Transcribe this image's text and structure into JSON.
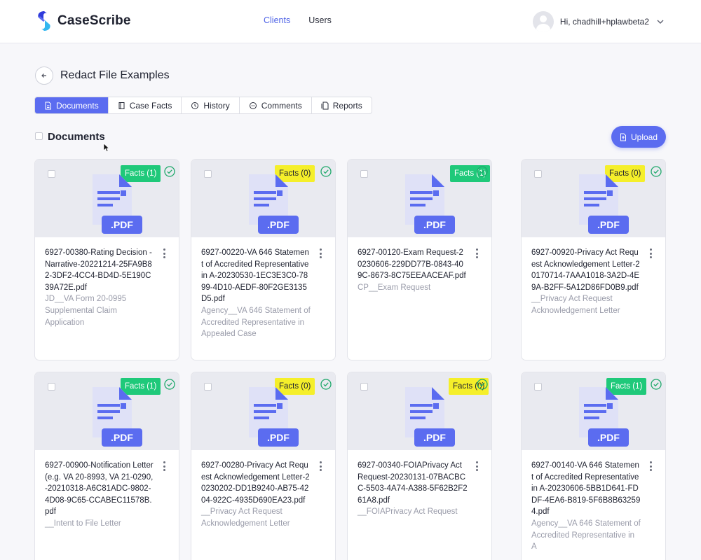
{
  "app": {
    "name": "CaseScribe"
  },
  "nav": {
    "clients": "Clients",
    "users": "Users"
  },
  "user": {
    "greeting": "Hi, chadhill+hplawbeta2"
  },
  "page": {
    "title": "Redact File Examples"
  },
  "tabs": [
    {
      "label": "Documents",
      "icon": "document-icon",
      "active": true
    },
    {
      "label": "Case Facts",
      "icon": "book-icon",
      "active": false
    },
    {
      "label": "History",
      "icon": "history-icon",
      "active": false
    },
    {
      "label": "Comments",
      "icon": "comments-icon",
      "active": false
    },
    {
      "label": "Reports",
      "icon": "reports-icon",
      "active": false
    }
  ],
  "section": {
    "title": "Documents",
    "upload_label": "Upload"
  },
  "colors": {
    "accent": "#5b6cf0",
    "facts_green": "#1fc97a",
    "facts_yellow": "#f5ef2a",
    "check_green": "#1ea86a"
  },
  "documents": [
    {
      "facts": "Facts (1)",
      "facts_color": "green",
      "name": "6927-00380-Rating Decision - Narrative-20221214-25FA9B82-3DF2-4CC4-BD4D-5E190C39A72E.pdf",
      "desc": "JD__VA Form 20-0995 Supplemental Claim Application"
    },
    {
      "facts": "Facts (0)",
      "facts_color": "yellow",
      "name": "6927-00220-VA 646 Statement of Accredited Representative in A-20230530-1EC3E3C0-7899-4D10-AEDF-80F2GE3135D5.pdf",
      "desc": "Agency__VA 646 Statement of Accredited Representative in Appealed Case"
    },
    {
      "facts": "Facts (1)",
      "facts_color": "green",
      "name": "6927-00120-Exam Request-20230606-229DD77B-0843-409C-8673-8C75EEAACEAF.pdf",
      "desc": "CP__Exam Request"
    },
    {
      "facts": "Facts (0)",
      "facts_color": "yellow",
      "name": "6927-00920-Privacy Act Request Acknowledgement Letter-20170714-7AAA1018-3A2D-4E9A-B2FF-5A12D86FD0B9.pdf",
      "desc": "__Privacy Act Request Acknowledgement Letter"
    },
    {
      "facts": "Facts (1)",
      "facts_color": "green",
      "name": "6927-00900-Notification Letter (e.g. VA 20-8993, VA 21-0290, -20210318-A6C81ADC-9802-4D08-9C65-CCABEC11578B.pdf",
      "desc": "__Intent to File Letter"
    },
    {
      "facts": "Facts (0)",
      "facts_color": "yellow",
      "name": "6927-00280-Privacy Act Request Acknowledgement Letter-20230202-DD1B9240-AB75-4204-922C-4935D690EA23.pdf",
      "desc": "__Privacy Act Request Acknowledgement Letter"
    },
    {
      "facts": "Facts (0)",
      "facts_color": "yellow",
      "name": "6927-00340-FOIAPrivacy Act Request-20230131-07BACBCC-5503-4A74-A388-5F62B2F261A8.pdf",
      "desc": "__FOIAPrivacy Act Request"
    },
    {
      "facts": "Facts (1)",
      "facts_color": "green",
      "name": "6927-00140-VA 646 Statement of Accredited Representative in A-20230606-5BB1D641-FDDF-4EA6-B819-5F6B8B632594.pdf",
      "desc": "Agency__VA 646 Statement of Accredited Representative in A"
    }
  ],
  "file_badge": ".PDF"
}
